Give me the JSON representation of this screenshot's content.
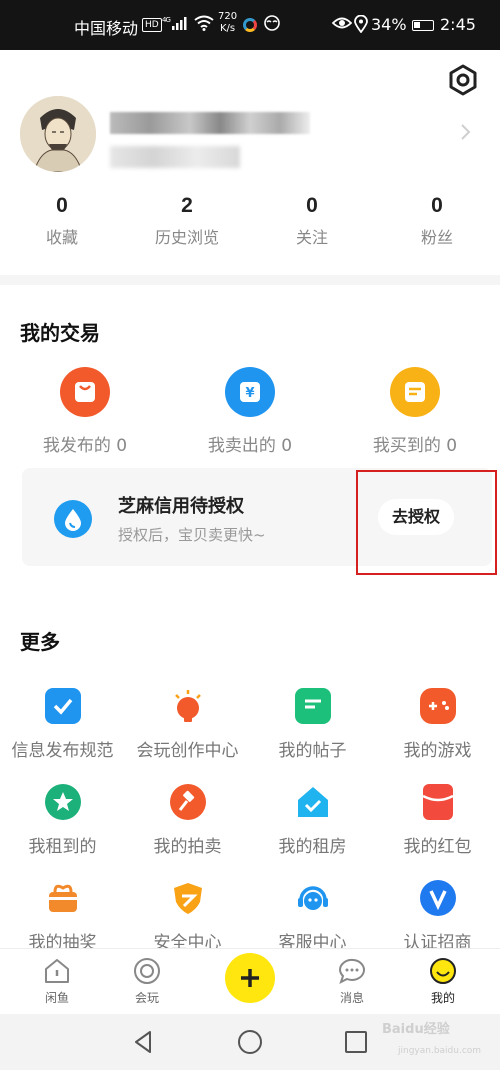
{
  "status_bar": {
    "carrier": "中国移动",
    "hd": "HD",
    "signal": "⁴ᴳ",
    "speed_value": "720",
    "speed_unit": "K/s",
    "battery": "34%",
    "time": "2:45"
  },
  "profile": {
    "stats": [
      {
        "value": "0",
        "label": "收藏"
      },
      {
        "value": "2",
        "label": "历史浏览"
      },
      {
        "value": "0",
        "label": "关注"
      },
      {
        "value": "0",
        "label": "粉丝"
      }
    ]
  },
  "trade": {
    "title": "我的交易",
    "items": [
      {
        "label": "我发布的 0",
        "icon": "bag-icon",
        "color": "#f25a2c"
      },
      {
        "label": "我卖出的 0",
        "icon": "yen-icon",
        "color": "#1f95f0"
      },
      {
        "label": "我买到的 0",
        "icon": "receipt-icon",
        "color": "#f9b215"
      }
    ],
    "zhima": {
      "title": "芝麻信用待授权",
      "subtitle": "授权后，宝贝卖更快~",
      "button": "去授权"
    }
  },
  "more": {
    "title": "更多",
    "items": [
      {
        "label": "信息发布规范",
        "icon": "check-doc-icon",
        "color": "#1f95f0"
      },
      {
        "label": "会玩创作中心",
        "icon": "bulb-icon",
        "color": "#f25a2c"
      },
      {
        "label": "我的帖子",
        "icon": "post-icon",
        "color": "#1cc07a"
      },
      {
        "label": "我的游戏",
        "icon": "gamepad-icon",
        "color": "#f25a2c"
      },
      {
        "label": "我租到的",
        "icon": "star-badge-icon",
        "color": "#1cb07a"
      },
      {
        "label": "我的拍卖",
        "icon": "hammer-icon",
        "color": "#f25a2c"
      },
      {
        "label": "我的租房",
        "icon": "house-check-icon",
        "color": "#1fb3f0"
      },
      {
        "label": "我的红包",
        "icon": "red-packet-icon",
        "color": "#f24a3c"
      },
      {
        "label": "我的抽奖",
        "icon": "gift-pot-icon",
        "color": "#f28a2c"
      },
      {
        "label": "安全中心",
        "icon": "shield-icon",
        "color": "#f9a215"
      },
      {
        "label": "客服中心",
        "icon": "headset-icon",
        "color": "#1f95f0"
      },
      {
        "label": "认证招商",
        "icon": "verified-v-icon",
        "color": "#1f7af0"
      }
    ]
  },
  "tabs": [
    {
      "label": "闲鱼"
    },
    {
      "label": "会玩"
    },
    {
      "label": "消息"
    },
    {
      "label": "我的"
    }
  ],
  "watermark": {
    "text": "Baidu经验",
    "sub": "jingyan.baidu.com"
  }
}
